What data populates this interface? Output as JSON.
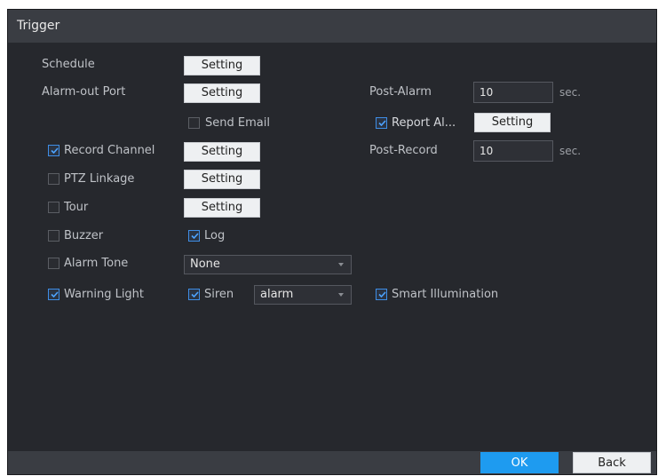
{
  "title": "Trigger",
  "accent_color": "#1e9bf0",
  "rows": {
    "schedule": {
      "label": "Schedule",
      "button": "Setting"
    },
    "alarm_out": {
      "label": "Alarm-out Port",
      "button": "Setting"
    },
    "send_email": {
      "label": "Send Email",
      "checked": false
    },
    "record_channel": {
      "label": "Record Channel",
      "button": "Setting",
      "checked": true
    },
    "ptz_linkage": {
      "label": "PTZ Linkage",
      "button": "Setting",
      "checked": false
    },
    "tour": {
      "label": "Tour",
      "button": "Setting",
      "checked": false
    },
    "buzzer": {
      "label": "Buzzer",
      "checked": false
    },
    "log": {
      "label": "Log",
      "checked": true
    },
    "alarm_tone": {
      "label": "Alarm Tone",
      "checked": false,
      "value": "None"
    },
    "warning_light": {
      "label": "Warning Light",
      "checked": true
    },
    "siren": {
      "label": "Siren",
      "checked": true,
      "value": "alarm"
    },
    "smart_illumination": {
      "label": "Smart Illumination",
      "checked": true
    }
  },
  "post_alarm": {
    "label": "Post-Alarm",
    "value": "10",
    "unit": "sec."
  },
  "report_alarm": {
    "label": "Report Al...",
    "button": "Setting",
    "checked": true
  },
  "post_record": {
    "label": "Post-Record",
    "value": "10",
    "unit": "sec."
  },
  "footer": {
    "ok": "OK",
    "back": "Back"
  }
}
